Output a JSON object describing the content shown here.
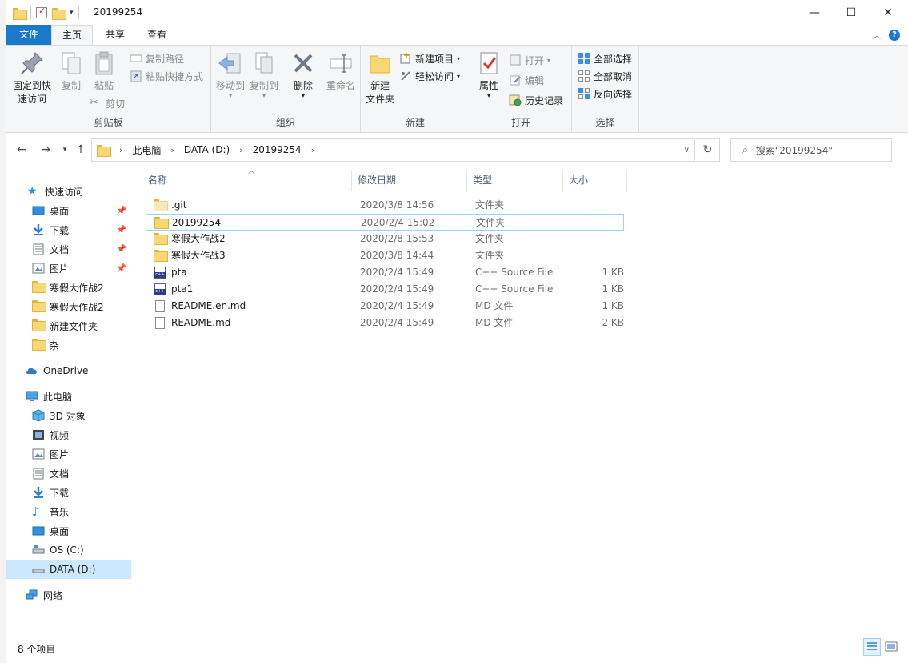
{
  "window": {
    "title": "20199254",
    "controls": {
      "minimize": "—",
      "maximize": "☐",
      "close": "✕"
    }
  },
  "tabs": {
    "file": "文件",
    "home": "主页",
    "share": "共享",
    "view": "查看"
  },
  "ribbon": {
    "clipboard": {
      "label": "剪贴板",
      "pin": "固定到快\n速访问",
      "pin_1": "固定到快",
      "pin_2": "速访问",
      "copy": "复制",
      "paste": "粘贴",
      "copy_path": "复制路径",
      "paste_shortcut": "粘贴快捷方式",
      "cut": "剪切"
    },
    "organize": {
      "label": "组织",
      "move_to": "移动到",
      "copy_to": "复制到",
      "delete": "删除",
      "rename": "重命名"
    },
    "new": {
      "label": "新建",
      "new_item": "新建项目",
      "easy_access": "轻松访问",
      "new_folder_1": "新建",
      "new_folder_2": "文件夹"
    },
    "open": {
      "label": "打开",
      "properties": "属性",
      "open": "打开",
      "edit": "编辑",
      "history": "历史记录"
    },
    "select": {
      "label": "选择",
      "select_all": "全部选择",
      "select_none": "全部取消",
      "invert": "反向选择"
    }
  },
  "address": {
    "crumbs": [
      "此电脑",
      "DATA (D:)",
      "20199254"
    ],
    "search_placeholder": "搜索\"20199254\""
  },
  "nav": {
    "quick_access": "快速访问",
    "desktop": "桌面",
    "downloads": "下载",
    "documents": "文档",
    "pictures": "图片",
    "hanjia2a": "寒假大作战2",
    "hanjia2b": "寒假大作战2",
    "new_folder": "新建文件夹",
    "za": "杂",
    "onedrive": "OneDrive",
    "this_pc": "此电脑",
    "objects3d": "3D 对象",
    "videos": "视频",
    "pictures2": "图片",
    "documents2": "文档",
    "downloads2": "下载",
    "music": "音乐",
    "desktop2": "桌面",
    "os_c": "OS (C:)",
    "data_d": "DATA (D:)",
    "network": "网络"
  },
  "columns": {
    "name": "名称",
    "date": "修改日期",
    "type": "类型",
    "size": "大小"
  },
  "files": [
    {
      "name": ".git",
      "date": "2020/3/8 14:56",
      "type": "文件夹",
      "size": "",
      "icon": "folder-light"
    },
    {
      "name": "20199254",
      "date": "2020/2/4 15:02",
      "type": "文件夹",
      "size": "",
      "icon": "folder"
    },
    {
      "name": "寒假大作战2",
      "date": "2020/2/8 15:53",
      "type": "文件夹",
      "size": "",
      "icon": "folder"
    },
    {
      "name": "寒假大作战3",
      "date": "2020/3/8 14:44",
      "type": "文件夹",
      "size": "",
      "icon": "folder"
    },
    {
      "name": "pta",
      "date": "2020/2/4 15:49",
      "type": "C++ Source File",
      "size": "1 KB",
      "icon": "cpp"
    },
    {
      "name": "pta1",
      "date": "2020/2/4 15:49",
      "type": "C++ Source File",
      "size": "1 KB",
      "icon": "cpp"
    },
    {
      "name": "README.en.md",
      "date": "2020/2/4 15:49",
      "type": "MD 文件",
      "size": "1 KB",
      "icon": "doc"
    },
    {
      "name": "README.md",
      "date": "2020/2/4 15:49",
      "type": "MD 文件",
      "size": "2 KB",
      "icon": "doc"
    }
  ],
  "status": {
    "count": "8 个项目"
  },
  "colors": {
    "accent": "#1979ca",
    "selection": "#cce8ff",
    "folder": "#f8d775"
  }
}
